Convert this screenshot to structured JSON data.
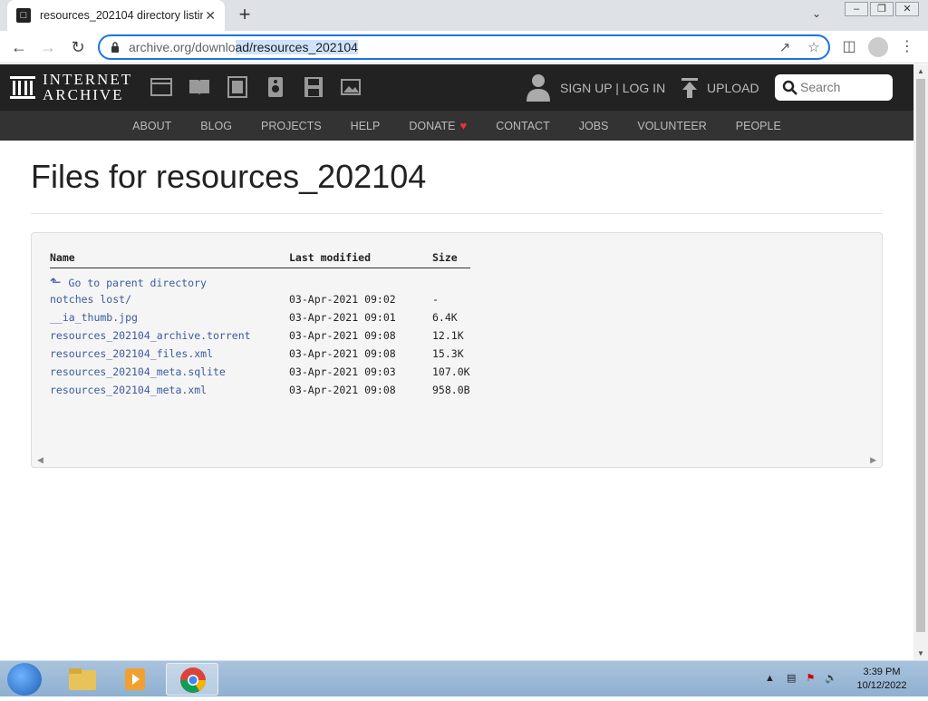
{
  "browser": {
    "tab_title": "resources_202104 directory listin",
    "url_host": "archive.org/downlo",
    "url_mid": "ad/resources_202104",
    "url_prefix": "archive.org/downlo",
    "url_rest_plain": "",
    "url_full": "archive.org/download/resources_202104"
  },
  "header": {
    "logo_line1": "INTERNET",
    "logo_line2": "ARCHIVE",
    "signup": "SIGN UP | LOG IN",
    "upload": "UPLOAD",
    "search_placeholder": "Search"
  },
  "nav": {
    "items": [
      "ABOUT",
      "BLOG",
      "PROJECTS",
      "HELP",
      "DONATE",
      "CONTACT",
      "JOBS",
      "VOLUNTEER",
      "PEOPLE"
    ]
  },
  "main": {
    "title": "Files for resources_202104",
    "columns": {
      "name": "Name",
      "modified": "Last modified",
      "size": "Size"
    },
    "parent_link": "Go to parent directory",
    "files": [
      {
        "name": "notches lost/",
        "modified": "03-Apr-2021 09:02",
        "size": "-"
      },
      {
        "name": "__ia_thumb.jpg",
        "modified": "03-Apr-2021 09:01",
        "size": "6.4K"
      },
      {
        "name": "resources_202104_archive.torrent",
        "modified": "03-Apr-2021 09:08",
        "size": "12.1K"
      },
      {
        "name": "resources_202104_files.xml",
        "modified": "03-Apr-2021 09:08",
        "size": "15.3K"
      },
      {
        "name": "resources_202104_meta.sqlite",
        "modified": "03-Apr-2021 09:03",
        "size": "107.0K"
      },
      {
        "name": "resources_202104_meta.xml",
        "modified": "03-Apr-2021 09:08",
        "size": "958.0B"
      }
    ]
  },
  "taskbar": {
    "time": "3:39 PM",
    "date": "10/12/2022"
  },
  "colors": {
    "link": "#3b5b9e",
    "header_bg": "#222222",
    "nav_bg": "#333333",
    "omnibox_focus": "#1a73e8"
  }
}
